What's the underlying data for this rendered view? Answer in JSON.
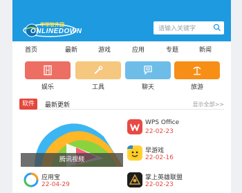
{
  "header": {
    "logo_cn": "华军软件园",
    "logo_text": "ONLINEDOWN",
    "search_placeholder": "请输入关键字"
  },
  "nav": [
    "首页",
    "最新",
    "游戏",
    "应用",
    "专题",
    "新闻"
  ],
  "categories": [
    {
      "label": "娱乐",
      "color": "#ed6e63",
      "icon": "film-icon"
    },
    {
      "label": "工具",
      "color": "#f5c77f",
      "icon": "wrench-icon"
    },
    {
      "label": "聊天",
      "color": "#6ebde8",
      "icon": "chat-icon"
    },
    {
      "label": "旅游",
      "color": "#f78f16",
      "icon": "travel-icon"
    }
  ],
  "section": {
    "tag": "软件",
    "title": "最新更新",
    "more": "显示全部>>"
  },
  "feature": {
    "caption": "腾讯视频"
  },
  "apps": [
    {
      "name": "WPS Office",
      "date": "22-02-23"
    },
    {
      "name": "早游戏",
      "date": "22-02-16"
    },
    {
      "name": "应用宝",
      "date": "22-04-29"
    },
    {
      "name": "掌上英雄联盟",
      "date": "22-02-23"
    }
  ]
}
